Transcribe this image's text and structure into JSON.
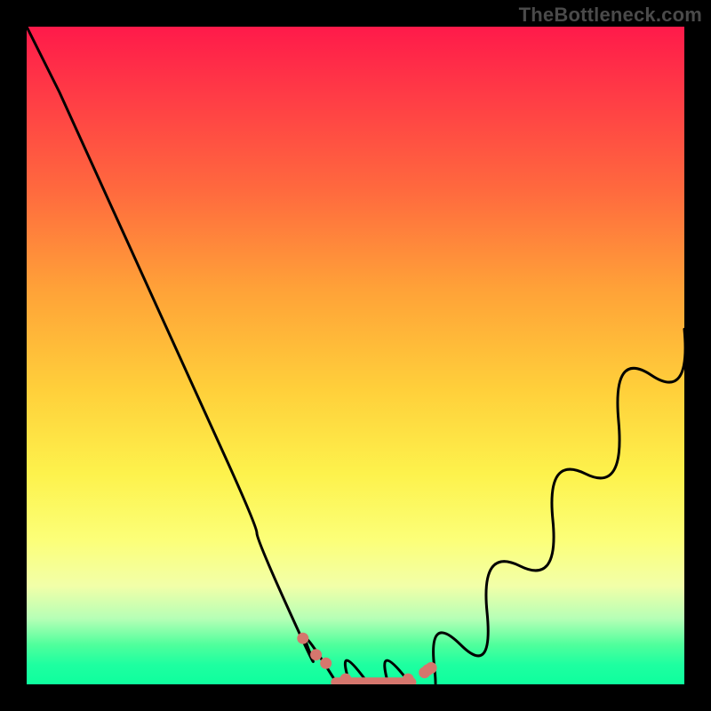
{
  "watermark": "TheBottleneck.com",
  "colors": {
    "frame": "#000000",
    "curve": "#000000",
    "marker": "#d5766d",
    "gradient_top": "#ff1a4a",
    "gradient_bottom": "#0eff9e"
  },
  "chart_data": {
    "type": "line",
    "title": "",
    "xlabel": "",
    "ylabel": "",
    "xlim": [
      0,
      100
    ],
    "ylim": [
      0,
      100
    ],
    "series": [
      {
        "name": "bottleneck-curve",
        "x": [
          0,
          5,
          10,
          15,
          20,
          25,
          30,
          35,
          40,
          43,
          46,
          49,
          52,
          55,
          58,
          62,
          66,
          70,
          75,
          80,
          85,
          90,
          95,
          100
        ],
        "values": [
          100,
          90,
          79,
          68,
          57,
          46,
          35,
          23,
          11,
          5,
          2,
          0.5,
          0,
          0,
          0.5,
          2.5,
          6,
          11,
          18,
          25,
          32,
          40,
          47,
          54
        ]
      }
    ],
    "markers": {
      "name": "highlight-dots",
      "x": [
        42.0,
        44.0,
        45.5,
        48.5,
        58.0,
        60.5,
        61.0,
        61.5
      ],
      "values": [
        7.0,
        4.5,
        3.2,
        0.8,
        0.8,
        1.8,
        2.2,
        2.5
      ]
    },
    "flat_segment": {
      "name": "min-plateau",
      "x_start": 47.0,
      "x_end": 58.5,
      "y": 0.3
    },
    "notes": "Values are approximate readings from an unlabeled bottleneck-style V-curve over a rainbow gradient background. y=0 corresponds to the bottom (green) edge, y=100 to the top (red) edge."
  }
}
